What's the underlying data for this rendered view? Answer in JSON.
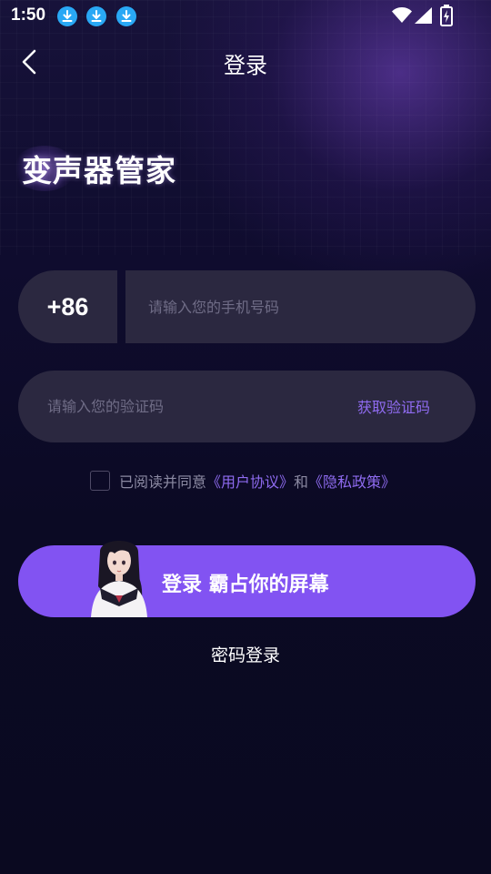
{
  "status_bar": {
    "time": "1:50",
    "icons": [
      "download-icon",
      "download-icon",
      "download-icon",
      "wifi-icon",
      "signal-icon",
      "battery-charging-icon"
    ]
  },
  "header": {
    "title": "登录",
    "back_icon": "chevron-left-icon"
  },
  "brand": {
    "title": "变声器管家"
  },
  "phone": {
    "country_code": "+86",
    "placeholder": "请输入您的手机号码",
    "value": ""
  },
  "code": {
    "placeholder": "请输入您的验证码",
    "value": "",
    "get_code_label": "获取验证码"
  },
  "agreement": {
    "checked": false,
    "prefix": "已阅读并同意",
    "user_agreement": "《用户协议》",
    "conjunction": "和",
    "privacy_policy": "《隐私政策》"
  },
  "login": {
    "label": "登录 霸占你的屏幕"
  },
  "password_login_label": "密码登录",
  "colors": {
    "background": "#0b0a24",
    "field": "#2b2840",
    "accent": "#8253f2",
    "link": "#8f6bf0",
    "download_badge": "#29a8f5"
  }
}
